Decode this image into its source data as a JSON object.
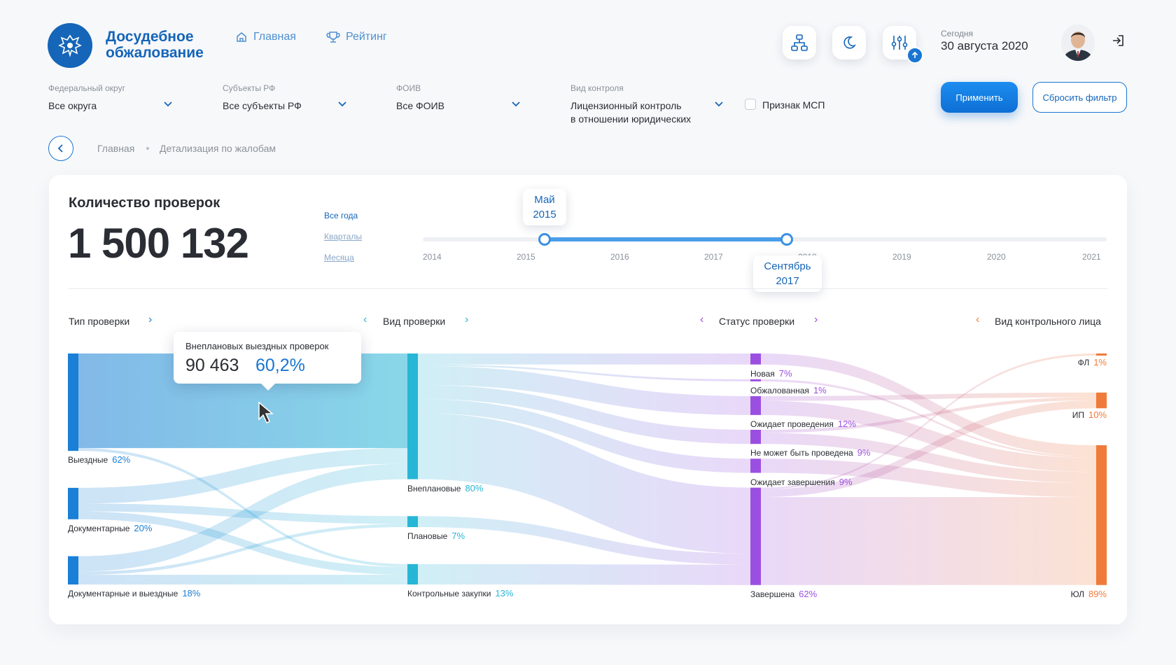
{
  "header": {
    "brand_line1": "Досудебное",
    "brand_line2": "обжалование",
    "nav": [
      {
        "label": "Главная",
        "icon": "home-icon"
      },
      {
        "label": "Рейтинг",
        "icon": "trophy-icon"
      }
    ],
    "today_label": "Сегодня",
    "today_value": "30 августа 2020",
    "accent": "#1976d2"
  },
  "filters": {
    "district": {
      "label": "Федеральный округ",
      "value": "Все округа"
    },
    "subjects": {
      "label": "Субъекты РФ",
      "value": "Все субъекты РФ"
    },
    "foiv": {
      "label": "ФОИВ",
      "value": "Все ФОИВ"
    },
    "control": {
      "label": "Вид контроля",
      "value_line1": "Лицензионный контроль",
      "value_line2": "в отношении юридических"
    },
    "msp_label": "Признак МСП",
    "apply_label": "Применить",
    "reset_label": "Сбросить фильтр"
  },
  "breadcrumb": {
    "home": "Главная",
    "current": "Детализация по жалобам"
  },
  "card": {
    "title": "Количество проверок",
    "total": "1 500 132",
    "periods": [
      "Все года",
      "Кварталы",
      "Месяца"
    ],
    "years": [
      "2014",
      "2015",
      "2016",
      "2017",
      "2018",
      "2019",
      "2020",
      "2021"
    ],
    "range_start": {
      "line1": "Май",
      "line2": "2015"
    },
    "range_end": {
      "line1": "Сентябрь",
      "line2": "2017"
    },
    "columns": [
      "Тип проверки",
      "Вид проверки",
      "Статус проверки",
      "Вид контрольного лица"
    ],
    "tooltip": {
      "title": "Внеплановых выездных проверок",
      "count": "90 463",
      "percent": "60,2%"
    }
  },
  "chart_data": {
    "type": "sankey",
    "columns": [
      "Тип проверки",
      "Вид проверки",
      "Статус проверки",
      "Вид контрольного лица"
    ],
    "nodes": [
      {
        "id": "t1",
        "name": "Выездные",
        "pct": "62%",
        "col": 0,
        "value": 62,
        "color": "#1a7fd6"
      },
      {
        "id": "t2",
        "name": "Документарные",
        "pct": "20%",
        "col": 0,
        "value": 20,
        "color": "#1a7fd6"
      },
      {
        "id": "t3",
        "name": "Документарные и выездные",
        "pct": "18%",
        "col": 0,
        "value": 18,
        "color": "#1a7fd6"
      },
      {
        "id": "v1",
        "name": "Внеплановые",
        "pct": "80%",
        "col": 1,
        "value": 80,
        "color": "#27b6d6"
      },
      {
        "id": "v2",
        "name": "Плановые",
        "pct": "7%",
        "col": 1,
        "value": 7,
        "color": "#27b6d6"
      },
      {
        "id": "v3",
        "name": "Контрольные закупки",
        "pct": "13%",
        "col": 1,
        "value": 13,
        "color": "#27b6d6"
      },
      {
        "id": "s1",
        "name": "Новая",
        "pct": "7%",
        "col": 2,
        "value": 7,
        "color": "#9b4fe0"
      },
      {
        "id": "s2",
        "name": "Обжалованная",
        "pct": "1%",
        "col": 2,
        "value": 1,
        "color": "#9b4fe0"
      },
      {
        "id": "s3",
        "name": "Ожидает проведения",
        "pct": "12%",
        "col": 2,
        "value": 12,
        "color": "#9b4fe0"
      },
      {
        "id": "s4",
        "name": "Не может быть проведена",
        "pct": "9%",
        "col": 2,
        "value": 9,
        "color": "#9b4fe0"
      },
      {
        "id": "s5",
        "name": "Ожидает завершения",
        "pct": "9%",
        "col": 2,
        "value": 9,
        "color": "#9b4fe0"
      },
      {
        "id": "s6",
        "name": "Завершена",
        "pct": "62%",
        "col": 2,
        "value": 62,
        "color": "#9b4fe0"
      },
      {
        "id": "p1",
        "name": "ФЛ",
        "pct": "1%",
        "col": 3,
        "value": 1,
        "color": "#f07a3a"
      },
      {
        "id": "p2",
        "name": "ИП",
        "pct": "10%",
        "col": 3,
        "value": 10,
        "color": "#f07a3a"
      },
      {
        "id": "p3",
        "name": "ЮЛ",
        "pct": "89%",
        "col": 3,
        "value": 89,
        "color": "#f07a3a"
      }
    ],
    "links": [
      {
        "source": "t1",
        "target": "v1",
        "value": 60.2
      },
      {
        "source": "t1",
        "target": "v3",
        "value": 1.8
      },
      {
        "source": "t2",
        "target": "v1",
        "value": 10
      },
      {
        "source": "t2",
        "target": "v2",
        "value": 5
      },
      {
        "source": "t2",
        "target": "v3",
        "value": 5
      },
      {
        "source": "t3",
        "target": "v1",
        "value": 9.8
      },
      {
        "source": "t3",
        "target": "v2",
        "value": 2
      },
      {
        "source": "t3",
        "target": "v3",
        "value": 6.2
      },
      {
        "source": "v1",
        "target": "s1",
        "value": 7
      },
      {
        "source": "v1",
        "target": "s2",
        "value": 1
      },
      {
        "source": "v1",
        "target": "s3",
        "value": 12
      },
      {
        "source": "v1",
        "target": "s4",
        "value": 9
      },
      {
        "source": "v1",
        "target": "s5",
        "value": 9
      },
      {
        "source": "v1",
        "target": "s6",
        "value": 42
      },
      {
        "source": "v2",
        "target": "s6",
        "value": 7
      },
      {
        "source": "v3",
        "target": "s6",
        "value": 13
      },
      {
        "source": "s1",
        "target": "p3",
        "value": 7
      },
      {
        "source": "s2",
        "target": "p3",
        "value": 1
      },
      {
        "source": "s3",
        "target": "p2",
        "value": 3
      },
      {
        "source": "s3",
        "target": "p3",
        "value": 9
      },
      {
        "source": "s4",
        "target": "p2",
        "value": 2
      },
      {
        "source": "s4",
        "target": "p3",
        "value": 7
      },
      {
        "source": "s5",
        "target": "p3",
        "value": 9
      },
      {
        "source": "s6",
        "target": "p1",
        "value": 1
      },
      {
        "source": "s6",
        "target": "p2",
        "value": 5
      },
      {
        "source": "s6",
        "target": "p3",
        "value": 56
      }
    ]
  }
}
